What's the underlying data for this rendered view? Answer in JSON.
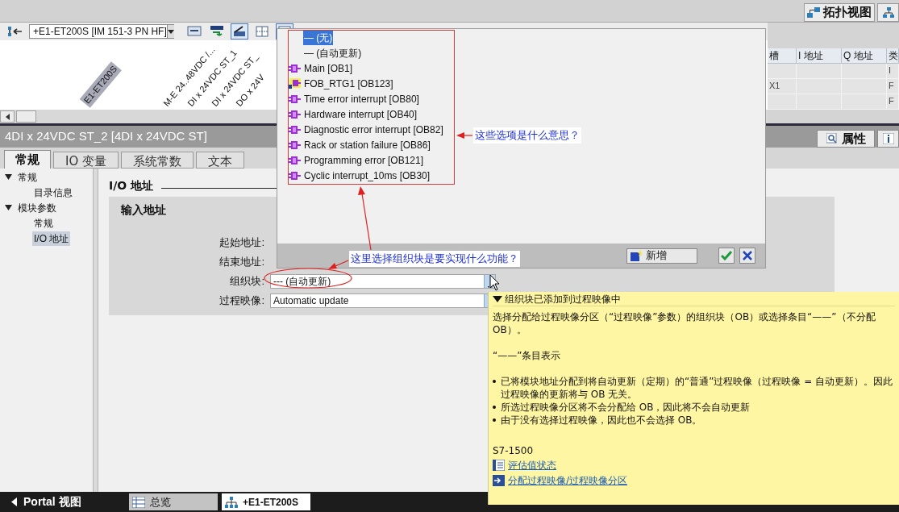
{
  "top_bar": {
    "view_button": "拓扑视图"
  },
  "toolbar": {
    "device": "+E1-ET200S [IM 151-3 PN HF]",
    "tools": [
      {
        "pressed": false
      },
      {
        "pressed": false
      },
      {
        "pressed": true
      },
      {
        "pressed": false
      },
      {
        "pressed": true
      }
    ]
  },
  "canvas": {
    "labels": [
      {
        "text": "E1-ET200S",
        "kind": "station"
      },
      {
        "text": "M-E 24..48VDC /...",
        "kind": "module"
      },
      {
        "text": "DI x 24VDC ST_1",
        "kind": "module"
      },
      {
        "text": "DI x 24VDC ST_",
        "kind": "module"
      },
      {
        "text": "DO x 24V",
        "kind": "module"
      }
    ]
  },
  "device_table": {
    "columns": [
      "槽",
      "I 地址",
      "Q 地址",
      "类"
    ],
    "rows": [
      [
        "",
        "",
        "",
        "I"
      ],
      [
        "X1",
        "",
        "",
        "F"
      ],
      [
        "",
        "",
        "",
        "F"
      ]
    ]
  },
  "inspector": {
    "title": "4DI x 24VDC ST_2 [4DI x 24VDC ST]",
    "panel_tab": "属性"
  },
  "tabs": [
    {
      "label": "常规",
      "selected": true
    },
    {
      "label": "IO 变量",
      "selected": false
    },
    {
      "label": "系统常数",
      "selected": false
    },
    {
      "label": "文本",
      "selected": false
    }
  ],
  "nav": [
    {
      "label": "常规",
      "expanded": true,
      "selected": false,
      "children": [
        {
          "label": "目录信息",
          "selected": false
        }
      ]
    },
    {
      "label": "模块参数",
      "expanded": true,
      "selected": false,
      "children": [
        {
          "label": "常规",
          "selected": false
        },
        {
          "label": "I/O 地址",
          "selected": true
        }
      ]
    }
  ],
  "section_title": "I/O 地址",
  "group_title": "输入地址",
  "fields": [
    {
      "label": "起始地址:"
    },
    {
      "label": "结束地址:"
    },
    {
      "label": "组织块:",
      "value": "--- (自动更新)"
    },
    {
      "label": "过程映像:",
      "value": "Automatic update"
    }
  ],
  "dropdown_popup": {
    "items": [
      {
        "label": "— (无)",
        "kind": "none",
        "selected": true
      },
      {
        "label": "— (自动更新)",
        "kind": "none",
        "selected": false
      },
      {
        "label": "Main [OB1]",
        "kind": "block",
        "selected": false
      },
      {
        "label": "FOB_RTG1 [OB123]",
        "kind": "protected_block",
        "selected": false
      },
      {
        "label": "Time error interrupt [OB80]",
        "kind": "block",
        "selected": false
      },
      {
        "label": "Hardware interrupt [OB40]",
        "kind": "block",
        "selected": false
      },
      {
        "label": "Diagnostic error interrupt [OB82]",
        "kind": "block",
        "selected": false
      },
      {
        "label": "Rack or station failure [OB86]",
        "kind": "block",
        "selected": false
      },
      {
        "label": "Programming error [OB121]",
        "kind": "block",
        "selected": false
      },
      {
        "label": "Cyclic interrupt_10ms [OB30]",
        "kind": "block",
        "selected": false
      }
    ],
    "add_button": "新增"
  },
  "annotations": [
    "这些选项是什么意思？",
    "这里选择组织块是要实现什么功能？"
  ],
  "tooltip": {
    "title": "组织块已添加到过程映像中",
    "intro": "选择分配给过程映像分区（“过程映像”参数）的组织块（OB）或选择条目“——”（不分配OB）。",
    "heading": "“——”条目表示",
    "bullets": [
      "已将模块地址分配到将自动更新（定期）的“普通”过程映像（过程映像 = 自动更新）。因此过程映像的更新将与 OB 无关。",
      "所选过程映像分区将不会分配给 OB，因此将不会自动更新",
      "由于没有选择过程映像，因此也不会选择 OB。"
    ],
    "device": "S7-1500",
    "links": [
      "评估值状态",
      "分配过程映像/过程映像分区"
    ]
  },
  "bottom_bar": {
    "portal": "Portal 视图",
    "tabs": [
      {
        "label": "总览",
        "selected": false
      },
      {
        "label": "+E1-ET200S",
        "selected": true
      }
    ]
  }
}
